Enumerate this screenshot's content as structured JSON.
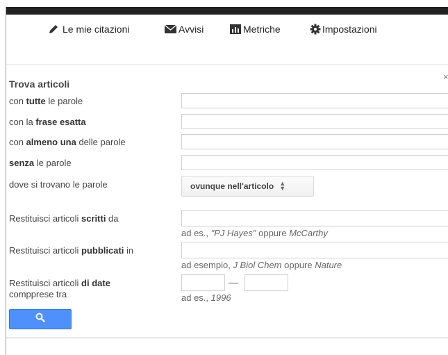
{
  "nav": {
    "citations": "Le mie citazioni",
    "alerts": "Avvisi",
    "metrics": "Metriche",
    "settings": "Impostazioni"
  },
  "form": {
    "close": "×",
    "title": "Trova articoli",
    "all_words": {
      "pre": "con ",
      "bold": "tutte",
      "post": " le parole",
      "value": ""
    },
    "exact_phrase": {
      "pre": "con la ",
      "bold": "frase esatta",
      "post": "",
      "value": ""
    },
    "at_least_one": {
      "pre": "con ",
      "bold": "almeno una",
      "post": " delle parole",
      "value": ""
    },
    "without": {
      "pre": "",
      "bold": "senza",
      "post": " le parole",
      "value": ""
    },
    "where": {
      "label": "dove si trovano le parole",
      "selected": "ovunque nell'articolo"
    },
    "author": {
      "pre": "Restituisci articoli ",
      "bold": "scritti",
      "post": " da",
      "value": "",
      "hint_pre": "ad es., ",
      "hint_i1": "\"PJ Hayes\"",
      "hint_mid": " oppure ",
      "hint_i2": "McCarthy"
    },
    "publication": {
      "pre": "Restituisci articoli ",
      "bold": "pubblicati",
      "post": " in",
      "value": "",
      "hint_pre": "ad esempio, ",
      "hint_i1": "J Biol Chem",
      "hint_mid": " oppure ",
      "hint_i2": "Nature"
    },
    "dates": {
      "pre": "Restituisci articoli ",
      "bold": "di date",
      "line2": "compprese tra",
      "from": "",
      "to": "",
      "dash": "—",
      "hint_pre": "ad es., ",
      "hint_i": "1996"
    }
  },
  "colors": {
    "accent": "#4d90fe",
    "topbar": "#222222"
  },
  "icons": {
    "citations": "pencil-icon",
    "alerts": "envelope-icon",
    "metrics": "bar-chart-icon",
    "settings": "gear-icon",
    "search": "magnifier-icon"
  }
}
